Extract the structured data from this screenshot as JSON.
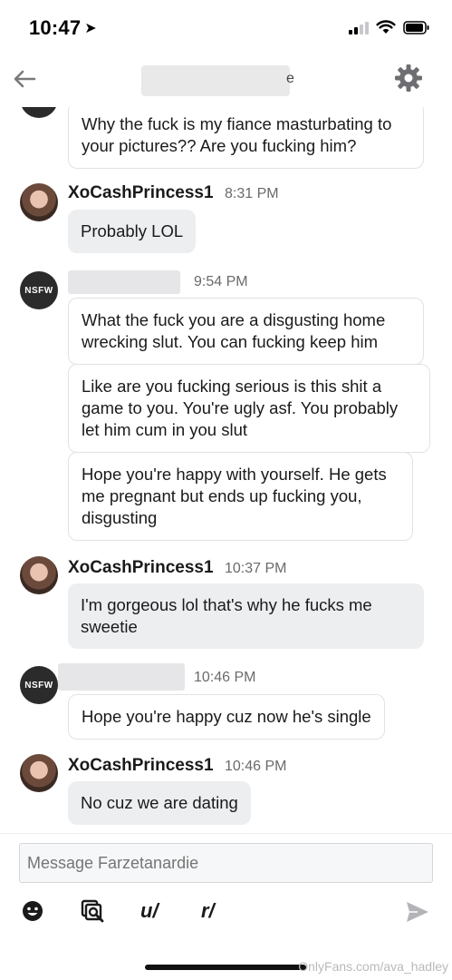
{
  "status_bar": {
    "time": "10:47",
    "location_arrow": "➤"
  },
  "nav": {
    "title_suffix": "e"
  },
  "messages": [
    {
      "text": "Why the fuck is my fiance masturbating to your pictures?? Are you fucking him?"
    },
    {
      "sender": "XoCashPrincess1",
      "time": "8:31 PM",
      "text": "Probably LOL"
    },
    {
      "time": "9:54 PM",
      "avatar_label": "NSFW",
      "texts": [
        "What the fuck you are a disgusting home wrecking slut. You can fucking keep him",
        "Like are you fucking serious is this shit a game to you. You're ugly asf. You probably let him cum in you slut",
        "Hope you're happy with yourself. He gets me pregnant but ends up fucking you, disgusting"
      ]
    },
    {
      "sender": "XoCashPrincess1",
      "time": "10:37 PM",
      "text": "I'm gorgeous lol that's why he fucks me sweetie"
    },
    {
      "time": "10:46 PM",
      "avatar_label": "NSFW",
      "text": "Hope you're happy cuz now he's single"
    },
    {
      "sender": "XoCashPrincess1",
      "time": "10:46 PM",
      "text": "No cuz we are dating"
    }
  ],
  "composer": {
    "placeholder": "Message Farzetanardie",
    "tools": {
      "user": "u/",
      "subreddit": "r/"
    }
  },
  "watermark": "OnlyFans.com/ava_hadley",
  "icons": [
    "back-arrow-icon",
    "gear-icon",
    "emoji-icon",
    "gif-search-icon",
    "send-icon"
  ]
}
